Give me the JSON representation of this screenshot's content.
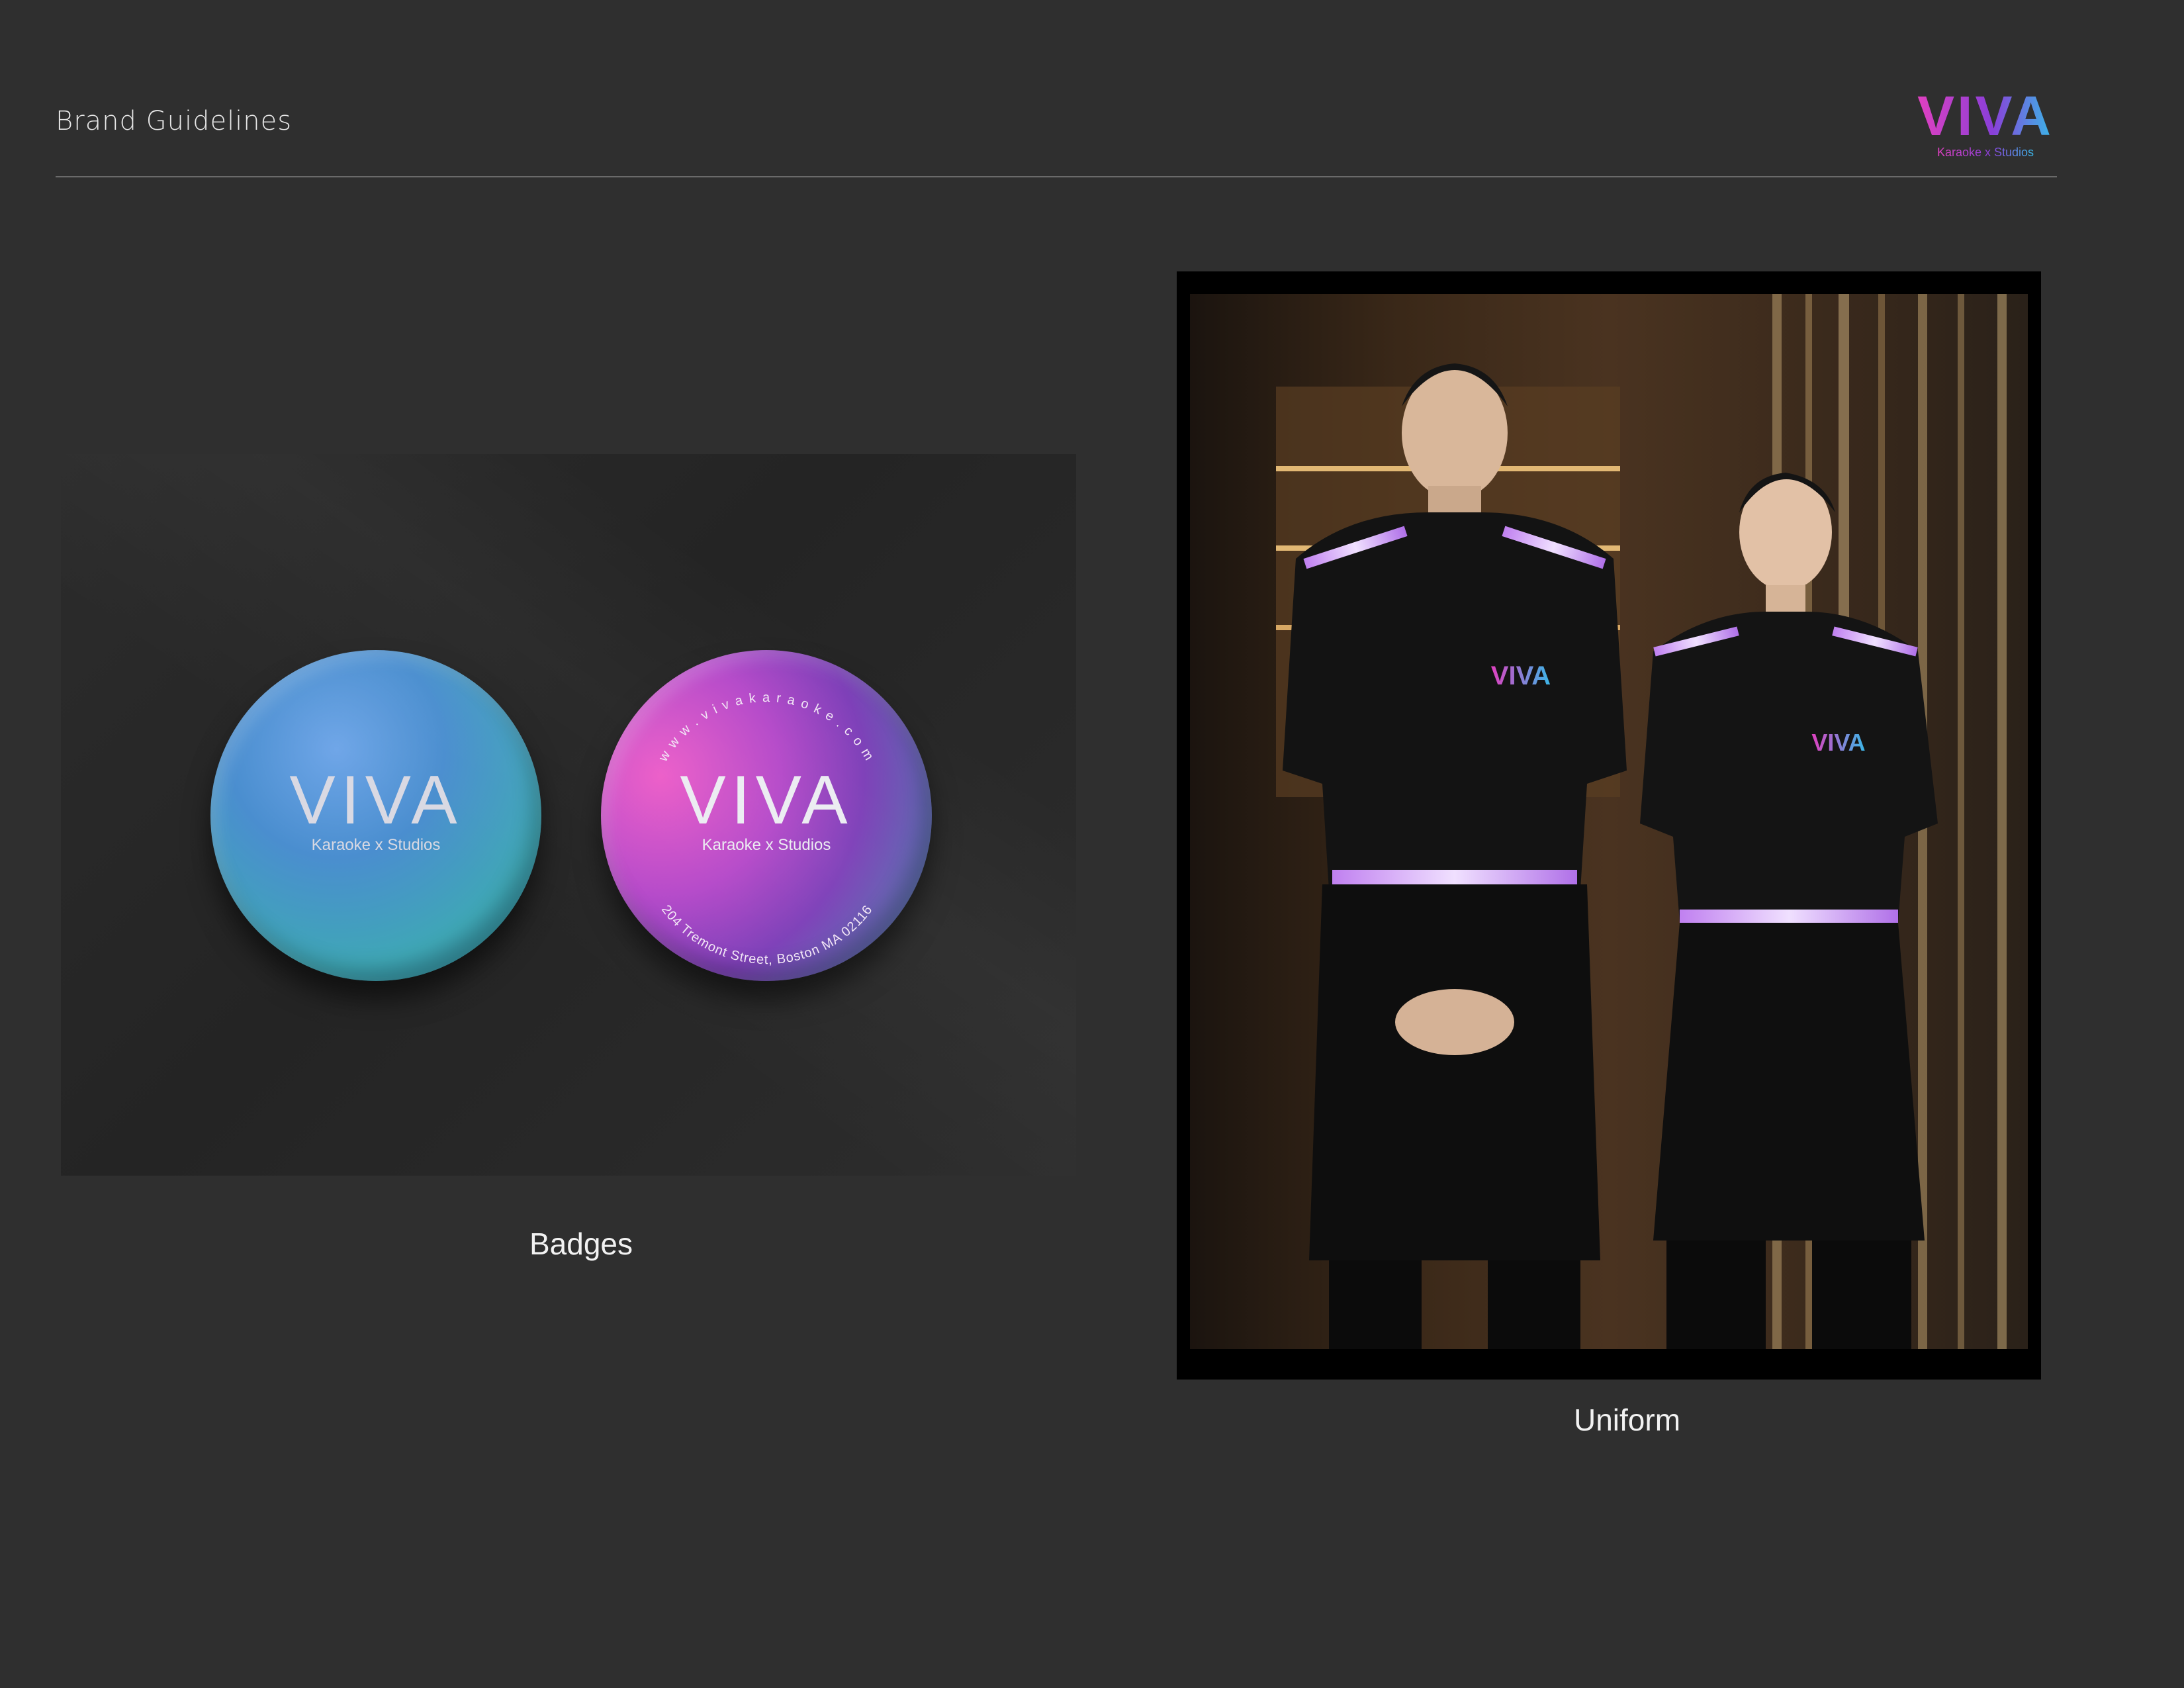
{
  "header": {
    "title": "Brand Guidelines",
    "logo": {
      "wordmark": "VIVA",
      "tagline": "Karaoke x Studios"
    }
  },
  "badges": {
    "items": [
      {
        "wordmark": "VIVA",
        "tagline": "Karaoke x Studios"
      },
      {
        "wordmark": "VIVA",
        "tagline": "Karaoke x Studios",
        "arc_top": "w w w . v i v a k a r a o k e . c o m",
        "arc_bottom": "204 Tremont Street, Boston MA 02116"
      }
    ],
    "caption": "Badges"
  },
  "uniform": {
    "shirt_logo": "VIVA",
    "caption": "Uniform"
  },
  "colors": {
    "background": "#2f2f2f",
    "brand_pink": "#e040c0",
    "brand_purple": "#8a3fd8",
    "brand_cyan": "#39b8e8"
  }
}
